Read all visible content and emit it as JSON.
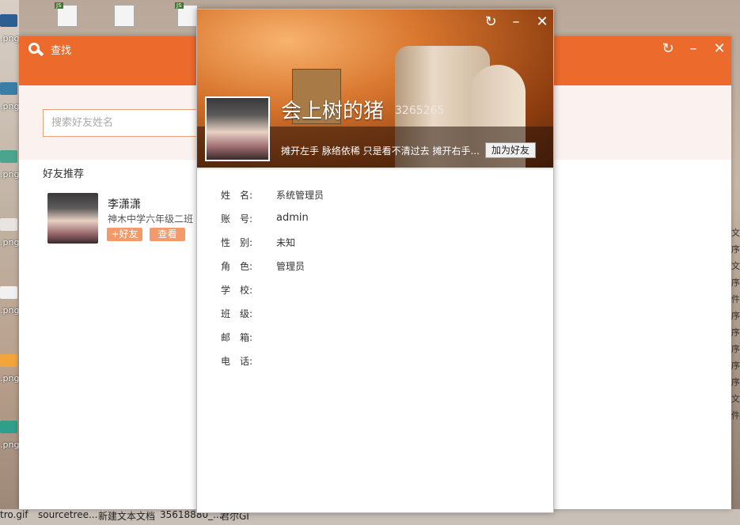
{
  "desktop": {
    "left_labels": [
      ".png",
      ".png",
      ".png",
      ".png",
      ".png",
      ".png",
      ".png"
    ],
    "bottom_items": [
      "tro.gif",
      "sourcetree...",
      "新建文本文档",
      "35618880_...",
      "君尔GI"
    ],
    "right_labels": [
      "文",
      "序",
      "文",
      "序",
      "件",
      "序",
      "序",
      "序",
      "序",
      "序",
      "文",
      "件"
    ],
    "top_icon_badge": "JS"
  },
  "find_window": {
    "title": "查找",
    "search_placeholder": "搜索好友姓名",
    "recommend_title": "好友推荐",
    "recommend": {
      "name": "李潇潇",
      "school": "神木中学六年级二班",
      "add_label": "+好友",
      "view_label": "查看"
    }
  },
  "profile_window": {
    "name": "会上树的猪",
    "id": "3265265",
    "signature": "摊开左手 脉络依稀 只是看不清过去 摊开右手...",
    "add_friend_label": "加为好友",
    "fields": [
      {
        "label": "姓　名:",
        "value": "系统管理员"
      },
      {
        "label": "账　号:",
        "value": "admin"
      },
      {
        "label": "性　别:",
        "value": "未知"
      },
      {
        "label": "角　色:",
        "value": "管理员"
      },
      {
        "label": "学　校:",
        "value": ""
      },
      {
        "label": "班　级:",
        "value": ""
      },
      {
        "label": "邮　箱:",
        "value": ""
      },
      {
        "label": "电　话:",
        "value": ""
      }
    ]
  },
  "colors": {
    "accent": "#ed6a2d",
    "button": "#f39a6a",
    "band": "#fbf2ef"
  },
  "icons": [
    "search-icon",
    "refresh-icon",
    "minimize-icon",
    "close-icon"
  ]
}
